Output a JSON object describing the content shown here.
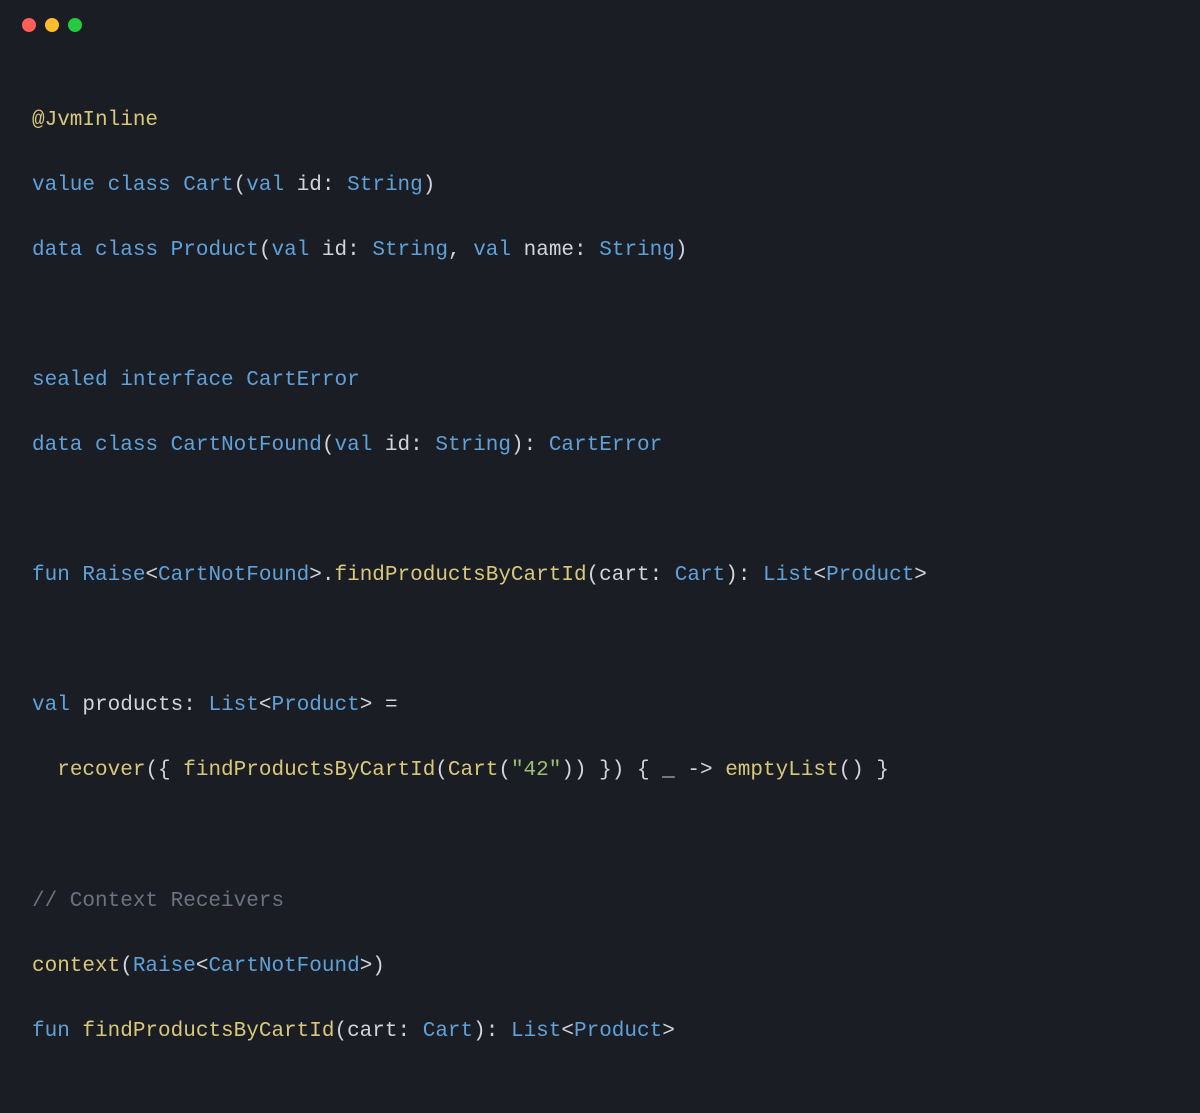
{
  "titlebar": {
    "close": "close",
    "minimize": "minimize",
    "zoom": "zoom"
  },
  "code": {
    "l1": {
      "annotation": "@JvmInline"
    },
    "l2": {
      "kw1": "value",
      "kw2": "class",
      "type": "Cart",
      "p1": "(",
      "kw3": "val",
      "ident": "id",
      "colon": ":",
      "ptype": "String",
      "p2": ")"
    },
    "l3": {
      "kw1": "data",
      "kw2": "class",
      "type": "Product",
      "p1": "(",
      "kw3": "val",
      "id1": "id",
      "c1": ":",
      "t1": "String",
      "comma": ",",
      "kw4": "val",
      "id2": "name",
      "c2": ":",
      "t2": "String",
      "p2": ")"
    },
    "l5": {
      "kw1": "sealed",
      "kw2": "interface",
      "type": "CartError"
    },
    "l6": {
      "kw1": "data",
      "kw2": "class",
      "type": "CartNotFound",
      "p1": "(",
      "kw3": "val",
      "id": "id",
      "c": ":",
      "t": "String",
      "p2": "):",
      "super": "CartError"
    },
    "l8": {
      "kw": "fun",
      "recv": "Raise",
      "lt": "<",
      "gen": "CartNotFound",
      "gt": ">.",
      "fn": "findProductsByCartId",
      "p1": "(",
      "param": "cart",
      "c": ":",
      "pt": "Cart",
      "p2": "):",
      "rt1": "List",
      "lt2": "<",
      "rt2": "Product",
      "gt2": ">"
    },
    "l10": {
      "kw": "val",
      "id": "products",
      "c": ":",
      "t1": "List",
      "lt": "<",
      "t2": "Product",
      "gt": ">",
      "eq": "="
    },
    "l11": {
      "indent": "  ",
      "fn1": "recover",
      "p1": "({ ",
      "fn2": "findProductsByCartId",
      "p2": "(",
      "fn3": "Cart",
      "p3": "(",
      "str": "\"42\"",
      "p4": ")) }) { _ -> ",
      "fn4": "emptyList",
      "p5": "() }"
    },
    "l13": {
      "comment": "// Context Receivers"
    },
    "l14": {
      "fn": "context",
      "p1": "(",
      "t1": "Raise",
      "lt": "<",
      "t2": "CartNotFound",
      "gt": ">",
      "p2": ")"
    },
    "l15": {
      "kw": "fun",
      "fn": "findProductsByCartId",
      "p1": "(",
      "param": "cart",
      "c": ":",
      "pt": "Cart",
      "p2": "):",
      "rt1": "List",
      "lt": "<",
      "rt2": "Product",
      "gt": ">"
    }
  }
}
